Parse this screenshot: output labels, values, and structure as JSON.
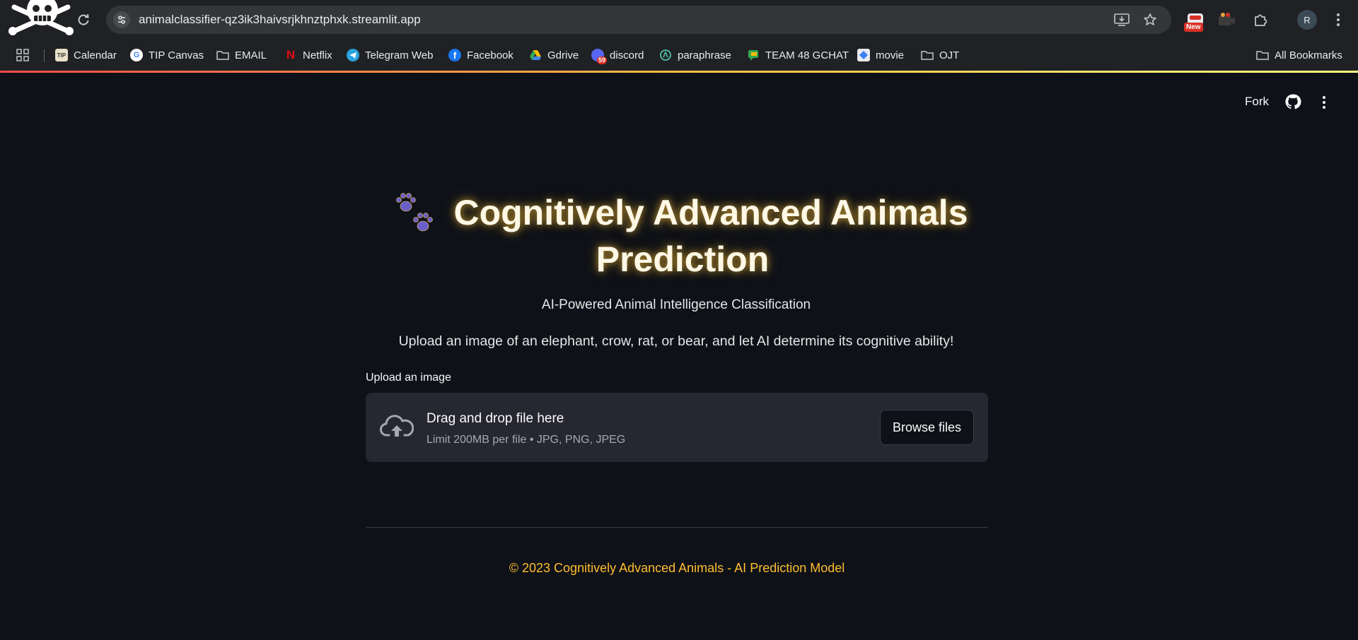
{
  "browser": {
    "url": "animalclassifier-qz3ik3haivsrjkhnztphxk.streamlit.app",
    "new_badge": "New",
    "profile_initial": "R",
    "bookmarks": [
      {
        "label": "Calendar",
        "icon": "calendar-icon"
      },
      {
        "label": "TIP Canvas",
        "icon": "google-icon"
      },
      {
        "label": "EMAIL",
        "icon": "folder-icon"
      },
      {
        "label": "Netflix",
        "icon": "netflix-icon"
      },
      {
        "label": "Telegram Web",
        "icon": "telegram-icon"
      },
      {
        "label": "Facebook",
        "icon": "facebook-icon"
      },
      {
        "label": "Gdrive",
        "icon": "gdrive-icon"
      },
      {
        "label": "discord",
        "icon": "discord-icon",
        "badge": "59"
      },
      {
        "label": "paraphrase",
        "icon": "paraphrase-icon"
      },
      {
        "label": "TEAM 48 GCHAT",
        "icon": "gchat-icon"
      },
      {
        "label": "movie",
        "icon": "movie-icon"
      },
      {
        "label": "OJT",
        "icon": "folder-icon"
      }
    ],
    "all_bookmarks": "All Bookmarks"
  },
  "header": {
    "fork_label": "Fork"
  },
  "main": {
    "title_line1": "Cognitively Advanced Animals",
    "title_line2": "Prediction",
    "subtitle": "AI-Powered Animal Intelligence Classification",
    "description": "Upload an image of an elephant, crow, rat, or bear, and let AI determine its cognitive ability!",
    "uploader": {
      "label": "Upload an image",
      "drop_text": "Drag and drop file here",
      "limit_text": "Limit 200MB per file • JPG, PNG, JPEG",
      "browse_label": "Browse files"
    },
    "footer": "© 2023 Cognitively Advanced Animals - AI Prediction Model"
  },
  "colors": {
    "page_background": "#0e1117",
    "title_glow": "#ffc83c",
    "footer_text": "#ffbd30",
    "dropzone_background": "#262730"
  }
}
